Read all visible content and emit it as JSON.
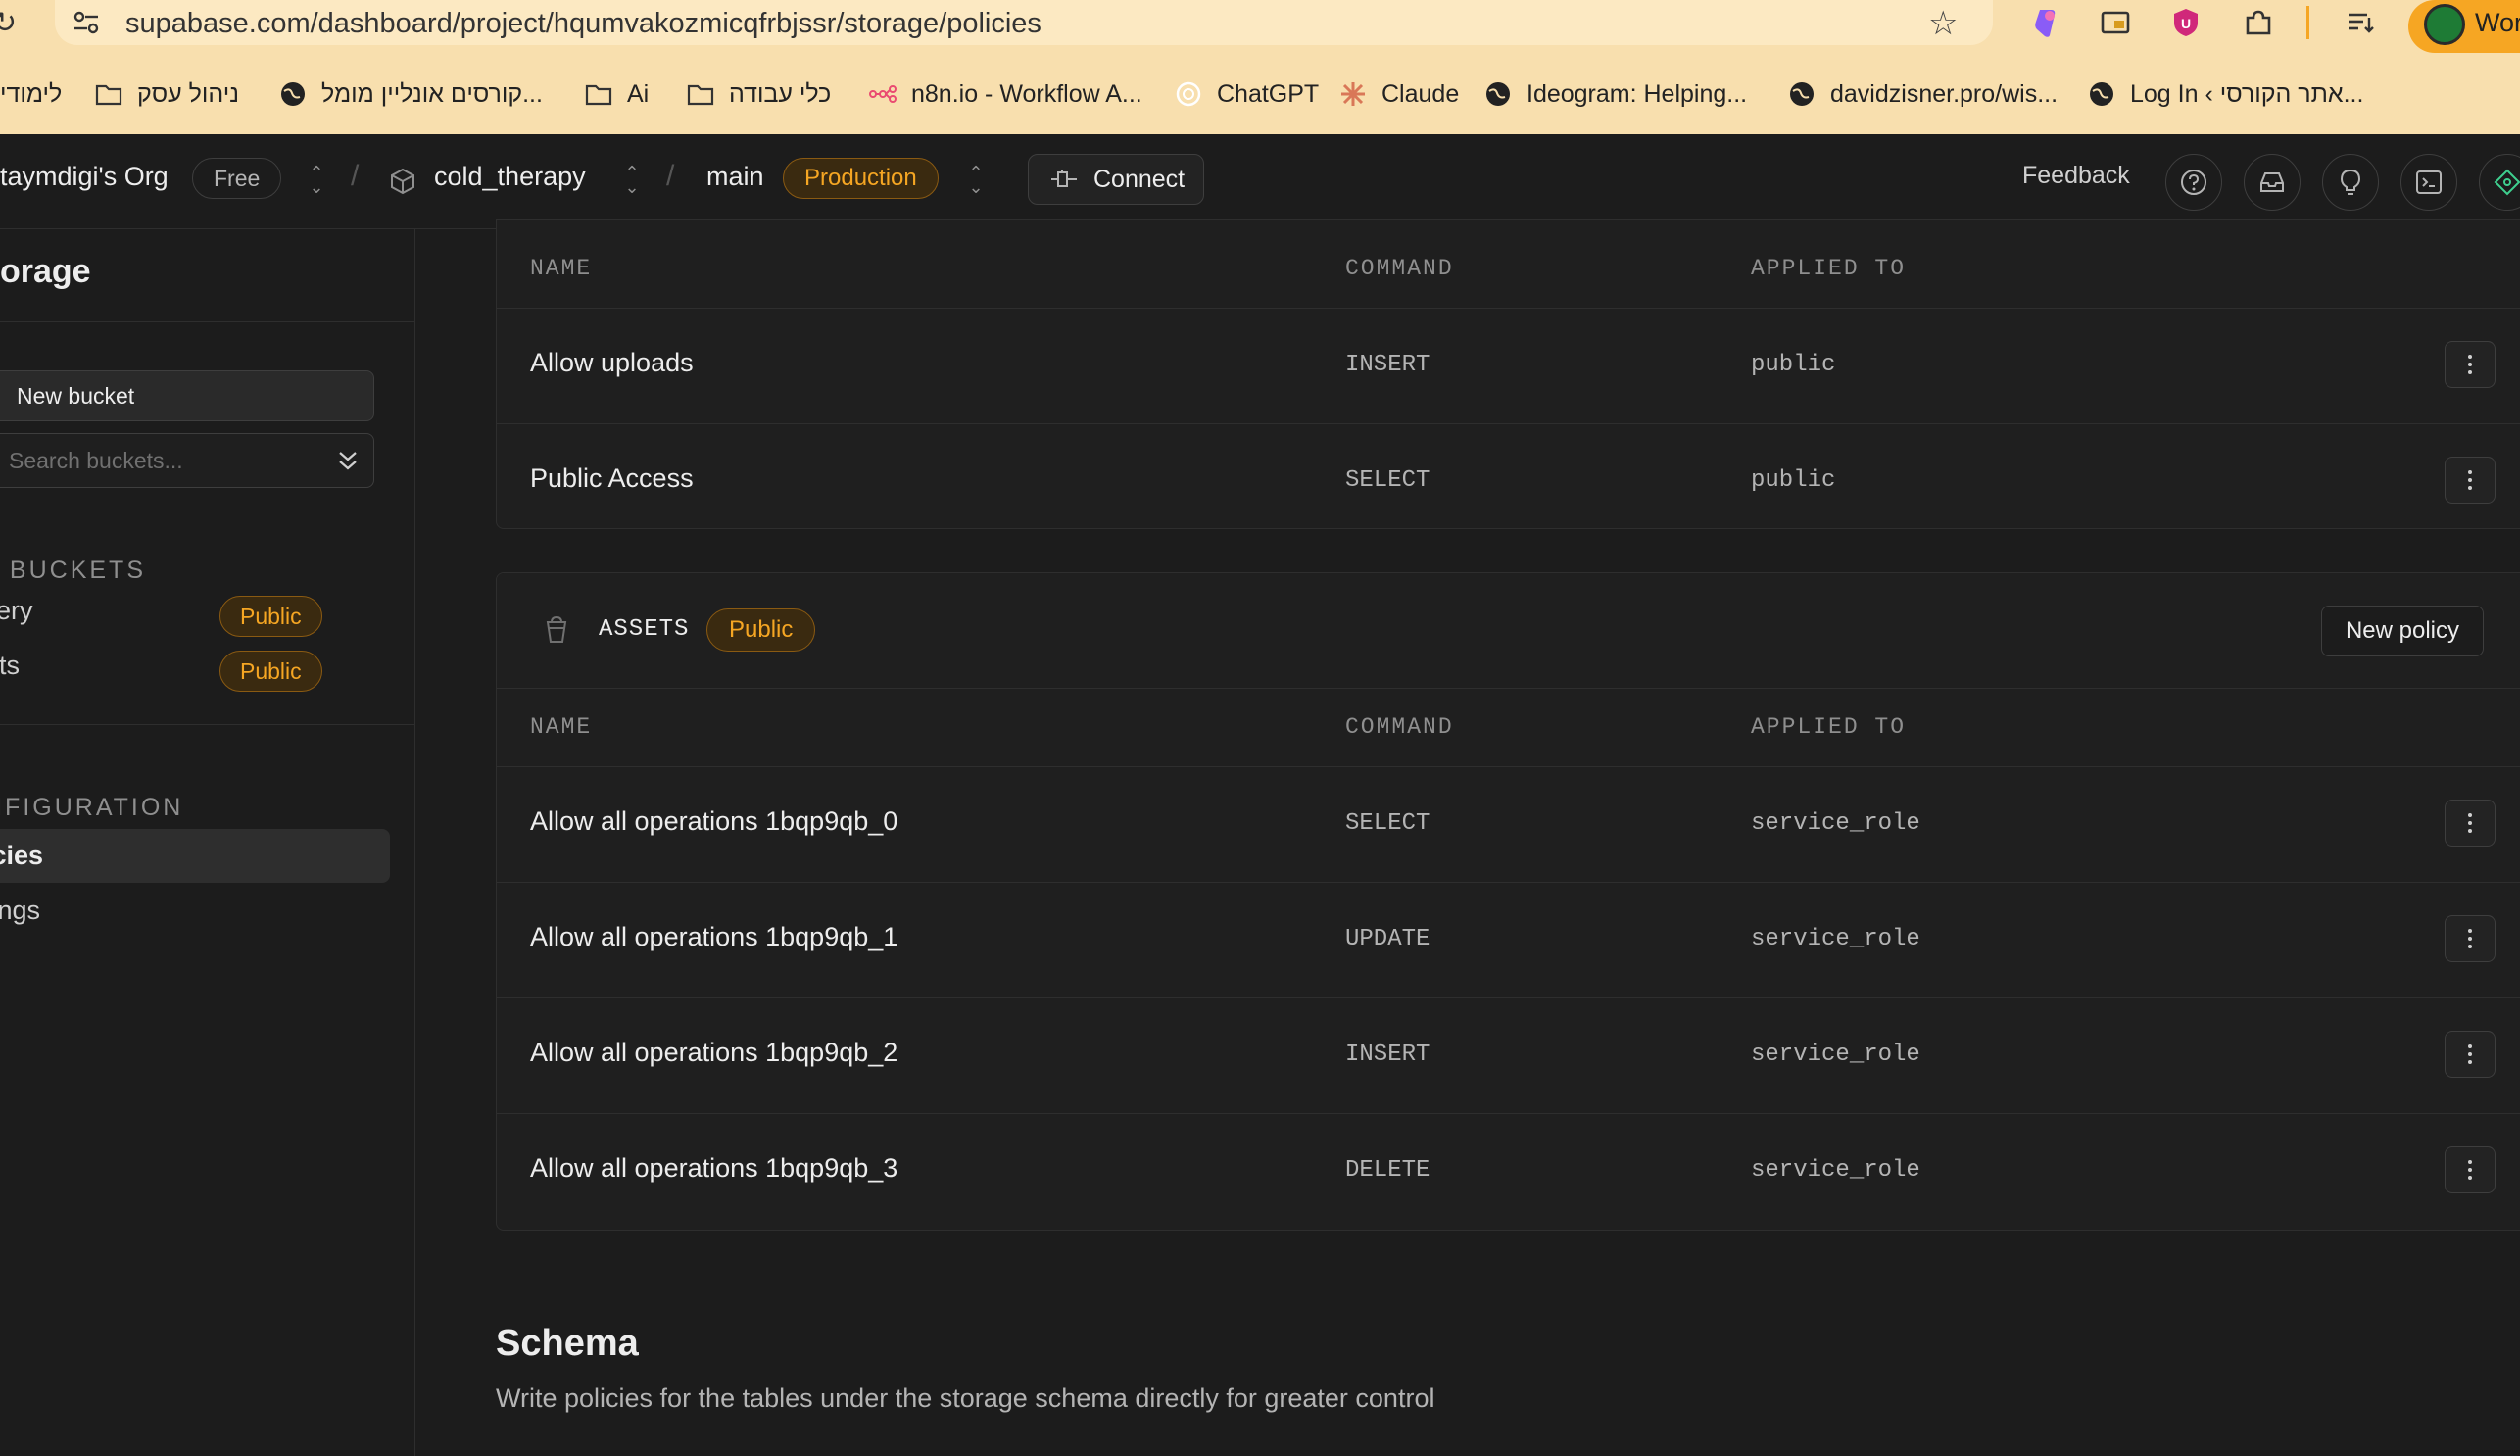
{
  "browser": {
    "url": "supabase.com/dashboard/project/hqumvakozmicqfrbjssr/storage/policies",
    "profile_label": "Wor",
    "bookmarks": [
      {
        "label": "לימודי",
        "icon": "none"
      },
      {
        "label": "ניהול עסק",
        "icon": "folder-icon"
      },
      {
        "label": "קורסים אונליין מומל...",
        "icon": "globe-icon"
      },
      {
        "label": "Ai",
        "icon": "folder-icon"
      },
      {
        "label": "כלי עבודה",
        "icon": "folder-icon"
      },
      {
        "label": "n8n.io - Workflow A...",
        "icon": "n8n-icon"
      },
      {
        "label": "ChatGPT",
        "icon": "chatgpt-icon"
      },
      {
        "label": "Claude",
        "icon": "claude-icon"
      },
      {
        "label": "Ideogram: Helping...",
        "icon": "globe-icon"
      },
      {
        "label": "davidzisner.pro/wis...",
        "icon": "globe-icon"
      },
      {
        "label": "Log In ‹ אתר הקורסי...",
        "icon": "globe-icon"
      }
    ]
  },
  "header": {
    "org_name": "taymdigi's Org",
    "plan_badge": "Free",
    "sep1": "/",
    "project_name": "cold_therapy",
    "sep2": "/",
    "branch": "main",
    "env_badge": "Production",
    "connect_label": "Connect",
    "feedback_label": "Feedback"
  },
  "sidebar": {
    "title": "orage",
    "new_bucket_label": "New bucket",
    "search_placeholder": "Search buckets...",
    "buckets_section": "L BUCKETS",
    "buckets": [
      {
        "name": "llery",
        "badge": "Public"
      },
      {
        "name": "ets",
        "badge": "Public"
      }
    ],
    "config_section": "NFIGURATION",
    "config_items": [
      {
        "label": "icies",
        "active": true
      },
      {
        "label": "tings",
        "active": false
      }
    ]
  },
  "main": {
    "columns": {
      "name": "NAME",
      "command": "COMMAND",
      "applied_to": "APPLIED TO"
    },
    "first_bucket_policies": [
      {
        "name": "Allow uploads",
        "command": "INSERT",
        "applied_to": "public"
      },
      {
        "name": "Public Access",
        "command": "SELECT",
        "applied_to": "public"
      }
    ],
    "assets_bucket": {
      "name": "ASSETS",
      "badge": "Public",
      "new_policy_label": "New policy",
      "policies": [
        {
          "name": "Allow all operations 1bqp9qb_0",
          "command": "SELECT",
          "applied_to": "service_role"
        },
        {
          "name": "Allow all operations 1bqp9qb_1",
          "command": "UPDATE",
          "applied_to": "service_role"
        },
        {
          "name": "Allow all operations 1bqp9qb_2",
          "command": "INSERT",
          "applied_to": "service_role"
        },
        {
          "name": "Allow all operations 1bqp9qb_3",
          "command": "DELETE",
          "applied_to": "service_role"
        }
      ]
    },
    "schema_title": "Schema",
    "schema_description": "Write policies for the tables under the storage schema directly for greater control"
  },
  "colors": {
    "accent_orange": "#f5a623",
    "browser_chrome": "#f8dfae",
    "background": "#1c1c1c"
  }
}
